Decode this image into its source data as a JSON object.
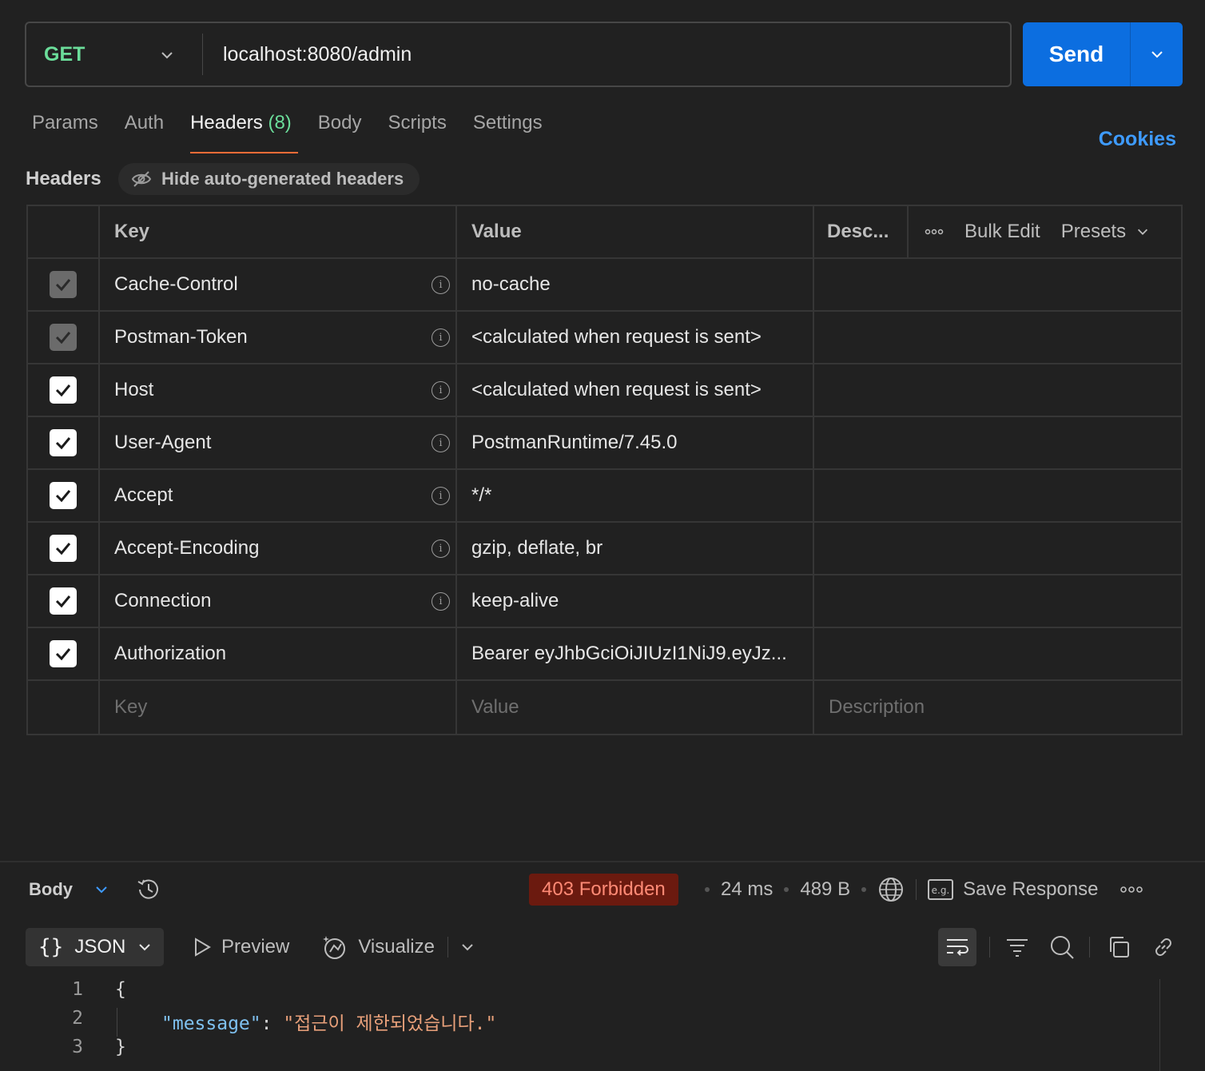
{
  "request": {
    "method": "GET",
    "url": "localhost:8080/admin",
    "send_label": "Send"
  },
  "tabs": [
    {
      "label": "Params"
    },
    {
      "label": "Auth"
    },
    {
      "label": "Headers",
      "count": "(8)",
      "active": true
    },
    {
      "label": "Body"
    },
    {
      "label": "Scripts"
    },
    {
      "label": "Settings"
    }
  ],
  "cookies_label": "Cookies",
  "headers_section": {
    "title": "Headers",
    "hide_auto_label": "Hide auto-generated headers"
  },
  "table": {
    "columns": {
      "key": "Key",
      "value": "Value",
      "description": "Desc..."
    },
    "actions": {
      "bulk_edit": "Bulk Edit",
      "presets": "Presets"
    },
    "rows": [
      {
        "key": "Cache-Control",
        "value": "no-cache",
        "checked": true,
        "auto": true
      },
      {
        "key": "Postman-Token",
        "value": "<calculated when request is sent>",
        "checked": true,
        "auto": true
      },
      {
        "key": "Host",
        "value": "<calculated when request is sent>",
        "checked": true,
        "auto": false
      },
      {
        "key": "User-Agent",
        "value": "PostmanRuntime/7.45.0",
        "checked": true,
        "auto": false
      },
      {
        "key": "Accept",
        "value": "*/*",
        "checked": true,
        "auto": false
      },
      {
        "key": "Accept-Encoding",
        "value": "gzip, deflate, br",
        "checked": true,
        "auto": false
      },
      {
        "key": "Connection",
        "value": "keep-alive",
        "checked": true,
        "auto": false
      },
      {
        "key": "Authorization",
        "value": "Bearer eyJhbGciOiJIUzI1NiJ9.eyJz...",
        "checked": true,
        "auto": false
      }
    ],
    "placeholders": {
      "key": "Key",
      "value": "Value",
      "description": "Description"
    }
  },
  "response": {
    "body_label": "Body",
    "status": "403 Forbidden",
    "time": "24 ms",
    "size": "489 B",
    "save_label": "Save Response",
    "format": "JSON",
    "preview_label": "Preview",
    "visualize_label": "Visualize",
    "code_lines": [
      "1",
      "2",
      "3"
    ],
    "json_key": "\"message\"",
    "json_value": "\"접근이 제한되었습니다.\""
  },
  "colors": {
    "accent": "#ff6c37",
    "send": "#0c6ee0",
    "method_get": "#6bdd9a",
    "status_error_bg": "#6b1a0f",
    "link": "#3e9bff"
  }
}
